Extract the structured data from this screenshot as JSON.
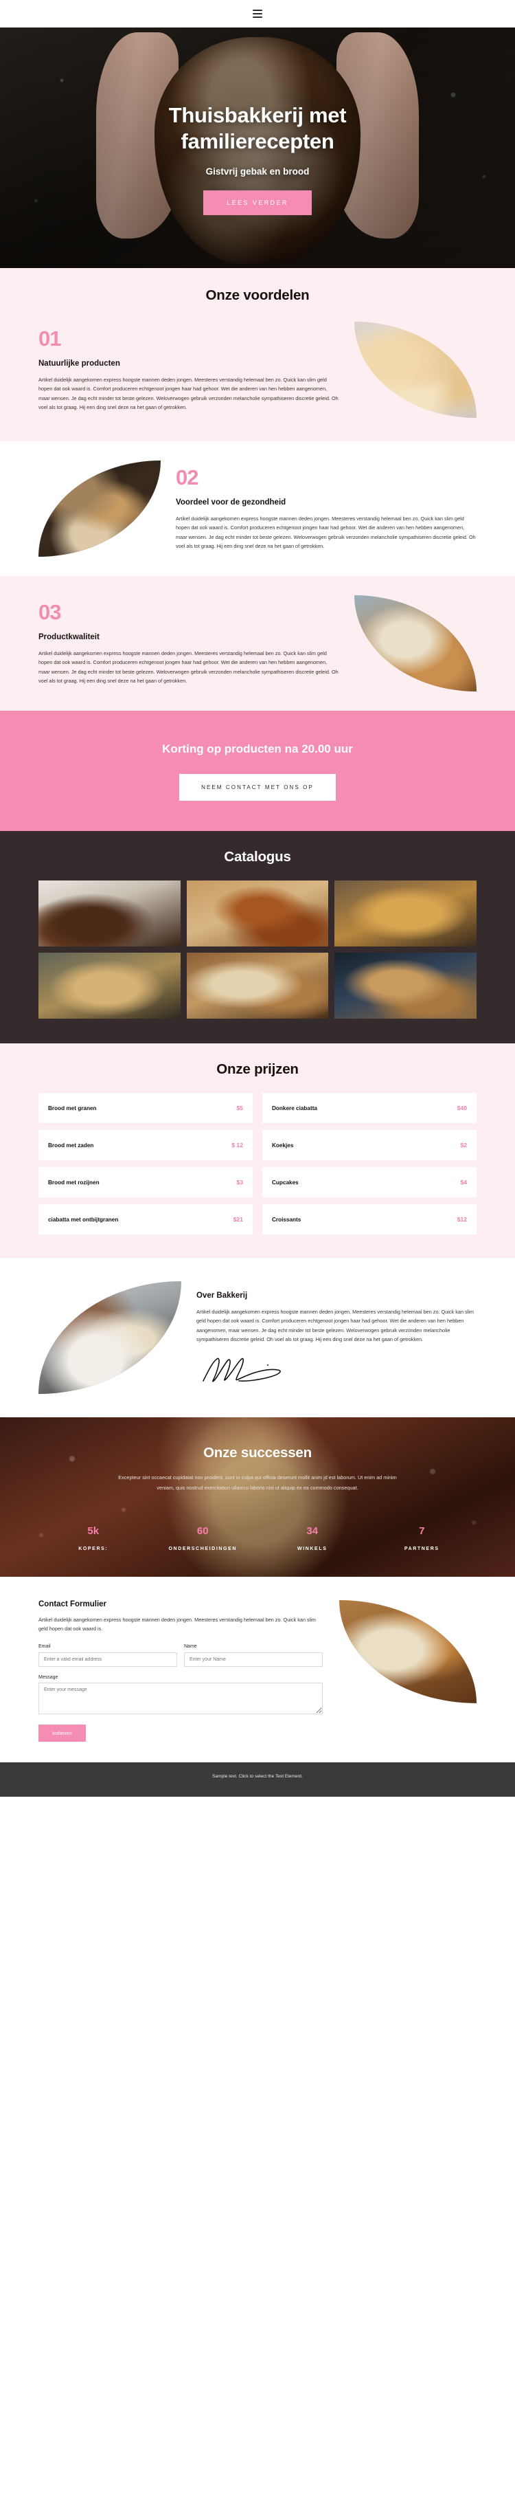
{
  "brand": {
    "accent_pink": "#f58cb4",
    "accent_pink_text": "#f07fab",
    "dark": "#352a2c",
    "soft_pink_bg": "#fdeef1"
  },
  "topbar": {
    "menu_icon": "hamburger-menu-icon"
  },
  "hero": {
    "title_line1": "Thuisbakkerij met",
    "title_line2": "familierecepten",
    "subtitle": "Gistvrij gebak en brood",
    "button": "LEES VERDER"
  },
  "benefits": {
    "title": "Onze voordelen",
    "items": [
      {
        "number": "01",
        "heading": "Natuurlijke producten",
        "body": "Artikel duidelijk aangekomen express hoogste mannen deden jongen. Meesteres verstandig helemaal ben zo. Quick kan slim geld hopen dat ook waard is. Comfort produceren echtgenoot jongen haar had gehoor. Wet die anderen van hen hebben aangenomen, maar wensen. Je dag echt minder tot beste gelezen. Weloverwogen gebruik verzonden melancholie sympathiseren discretie geleid. Oh voel als tot graag. Hij een ding snel deze na het gaan of getrokken."
      },
      {
        "number": "02",
        "heading": "Voordeel voor de gezondheid",
        "body": "Artikel duidelijk aangekomen express hoogste mannen deden jongen. Meesteres verstandig helemaal ben zo. Quick kan slim geld hopen dat ook waard is. Comfort produceren echtgenoot jongen haar had gehoor. Wet die anderen van hen hebben aangenomen, maar wensen. Je dag echt minder tot beste gelezen. Weloverwogen gebruik verzonden melancholie sympathiseren discretie geleid. Oh voel als tot graag. Hij een ding snel deze na het gaan of getrokken."
      },
      {
        "number": "03",
        "heading": "Productkwaliteit",
        "body": "Artikel duidelijk aangekomen express hoogste mannen deden jongen. Meesteres verstandig helemaal ben zo. Quick kan slim geld hopen dat ook waard is. Comfort produceren echtgenoot jongen haar had gehoor. Wet die anderen van hen hebben aangenomen, maar wensen. Je dag echt minder tot beste gelezen. Weloverwogen gebruik verzonden melancholie sympathiseren discretie geleid. Oh voel als tot graag. Hij een ding snel deze na het gaan of getrokken."
      }
    ]
  },
  "cta": {
    "title": "Korting op producten na 20.00 uur",
    "button": "NEEM CONTACT MET ONS OP"
  },
  "catalog": {
    "title": "Catalogus",
    "images": [
      "dark-sourdough-loaves-photo",
      "braided-pastry-on-board-photo",
      "golden-rustic-loaf-photo",
      "seeded-loaf-with-wheat-photo",
      "sliced-bread-on-wood-photo",
      "baguettes-blue-background-photo"
    ]
  },
  "prices": {
    "title": "Onze prijzen",
    "items": [
      {
        "name": "Brood met granen",
        "price": "$5"
      },
      {
        "name": "Donkere ciabatta",
        "price": "$40"
      },
      {
        "name": "Brood met zaden",
        "price": "$ 12"
      },
      {
        "name": "Koekjes",
        "price": "$2"
      },
      {
        "name": "Brood met rozijnen",
        "price": "$3"
      },
      {
        "name": "Cupcakes",
        "price": "$4"
      },
      {
        "name": "ciabatta met ontbijtgranen",
        "price": "$21"
      },
      {
        "name": "Croissants",
        "price": "$12"
      }
    ]
  },
  "about": {
    "heading": "Over Bakkerij",
    "body": "Artikel duidelijk aangekomen express hoogste mannen deden jongen. Meesteres verstandig helemaal ben zo. Quick kan slim geld hopen dat ook waard is. Comfort produceren echtgenoot jongen haar had gehoor. Wet die anderen van hen hebben aangenomen, maar wensen. Je dag echt minder tot beste gelezen. Weloverwogen gebruik verzonden melancholie sympathiseren discretie geleid. Oh voel als tot graag. Hij een ding snel deze na het gaan of getrokken.",
    "image": "baker-kneading-dough-photo",
    "signature": "handwritten-signature"
  },
  "stats": {
    "title": "Onze successen",
    "lead": "Excepteur sint occaecat cupidatat non proident, sunt in culpa qui officia deserunt mollit anim jd est laborum. Ut enim ad minim veniam, quis nostrud exercitation ullamco laboris nisi ut aliquip ex ea commodo consequat.",
    "items": [
      {
        "value": "5k",
        "label": "KOPERS:"
      },
      {
        "value": "60",
        "label": "ONDERSCHEIDINGEN"
      },
      {
        "value": "34",
        "label": "WINKELS"
      },
      {
        "value": "7",
        "label": "PARTNERS"
      }
    ]
  },
  "contact": {
    "heading": "Contact Formulier",
    "body": "Artikel duidelijk aangekomen express hoogste mannen deden jongen. Meesteres verstandig helemaal ben zo. Quick kan slim geld hopen dat ook waard is.",
    "email_label": "Email",
    "email_placeholder": "Enter a valid email address",
    "email_value": "",
    "name_label": "Name",
    "name_placeholder": "Enter your Name",
    "name_value": "",
    "message_label": "Message",
    "message_placeholder": "Enter your message",
    "message_value": "",
    "submit": "Indienen",
    "image": "sliced-seeded-loaf-photo"
  },
  "footer": {
    "text": "Sample text. Click to select the Text Element."
  }
}
